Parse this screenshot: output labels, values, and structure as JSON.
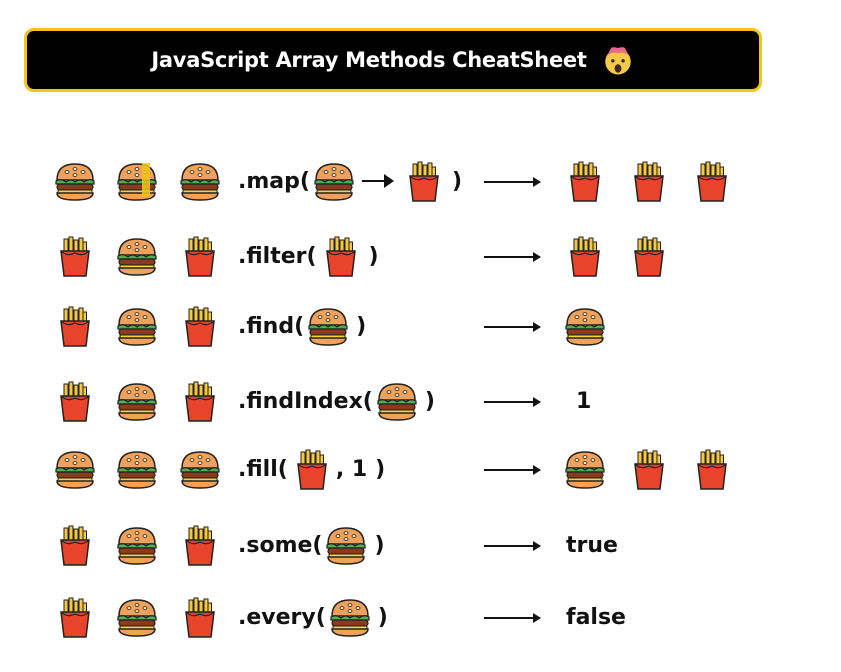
{
  "header": {
    "title": "JavaScript Array Methods CheatSheet",
    "emoji": "exploding-head-emoji"
  },
  "colors": {
    "banner_bg": "#000000",
    "banner_border": "#f5c518",
    "bun": "#f0a15a",
    "lettuce": "#4caf50",
    "patty": "#8a3b1f",
    "fries": "#f5c842",
    "fries_box": "#e8432b"
  },
  "rows": [
    {
      "id": "map",
      "input": [
        "burger",
        "burger",
        "burger"
      ],
      "method_open": ".map(",
      "method_args": [
        "burger",
        "arrow",
        "fries"
      ],
      "method_close": ")",
      "result": [
        "fries",
        "fries",
        "fries"
      ],
      "result_text": ""
    },
    {
      "id": "filter",
      "input": [
        "fries",
        "burger",
        "fries"
      ],
      "method_open": ".filter(",
      "method_args": [
        "fries"
      ],
      "method_close": ")",
      "result": [
        "fries",
        "fries"
      ],
      "result_text": ""
    },
    {
      "id": "find",
      "input": [
        "fries",
        "burger",
        "fries"
      ],
      "method_open": ".find(",
      "method_args": [
        "burger"
      ],
      "method_close": ")",
      "result": [
        "burger"
      ],
      "result_text": ""
    },
    {
      "id": "findIndex",
      "input": [
        "fries",
        "burger",
        "fries"
      ],
      "method_open": ".findIndex(",
      "method_args": [
        "burger"
      ],
      "method_close": ")",
      "result": [],
      "result_text": "1"
    },
    {
      "id": "fill",
      "input": [
        "burger",
        "burger",
        "burger"
      ],
      "method_open": ".fill(",
      "method_args": [
        "fries"
      ],
      "method_extra": ", 1",
      "method_close": ")",
      "result": [
        "burger",
        "fries",
        "fries"
      ],
      "result_text": ""
    },
    {
      "id": "some",
      "input": [
        "fries",
        "burger",
        "fries"
      ],
      "method_open": ".some(",
      "method_args": [
        "burger"
      ],
      "method_close": ")",
      "result": [],
      "result_text": "true"
    },
    {
      "id": "every",
      "input": [
        "fries",
        "burger",
        "fries"
      ],
      "method_open": ".every(",
      "method_args": [
        "burger"
      ],
      "method_close": ")",
      "result": [],
      "result_text": "false"
    }
  ]
}
